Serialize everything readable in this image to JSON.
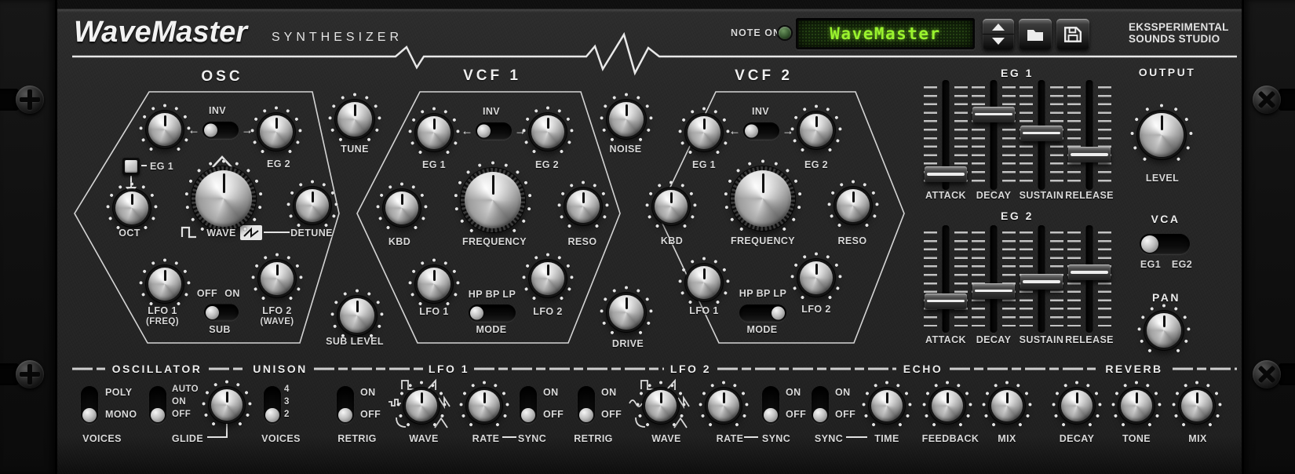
{
  "header": {
    "brand": "WaveMaster",
    "tagline": "SYNTHESIZER",
    "note_on": "NOTE ON",
    "lcd_text": "WaveMaster",
    "studio_line1": "EKSSPERIMENTAL",
    "studio_line2": "SOUNDS STUDIO"
  },
  "colors": {
    "lcd_green": "#9af22e",
    "panel": "#242424",
    "label": "#d9d9d9"
  },
  "osc": {
    "title": "OSC",
    "inv_label": "INV",
    "inv_state": "left",
    "eg1_label": "EG 1",
    "eg2_label": "EG 2",
    "oct_label": "OCT",
    "wave_label": "WAVE",
    "detune_label": "DETUNE",
    "lfo1_label": "LFO 1",
    "lfo1_sub": "(FREQ)",
    "sub_off": "OFF",
    "sub_on": "ON",
    "sub_label": "SUB",
    "sub_state": "left",
    "sub_selected": "OFF",
    "lfo2_label": "LFO 2",
    "lfo2_sub": "(WAVE)"
  },
  "tune_label": "TUNE",
  "sub_level_label": "SUB LEVEL",
  "noise_label": "NOISE",
  "drive_label": "DRIVE",
  "vcf1": {
    "title": "VCF 1",
    "inv_label": "INV",
    "inv_state": "left",
    "eg1_label": "EG 1",
    "eg2_label": "EG 2",
    "kbd_label": "KBD",
    "frequency_label": "FREQUENCY",
    "reso_label": "RESO",
    "lfo1_label": "LFO 1",
    "lfo2_label": "LFO 2",
    "mode_options": "HP BP LP",
    "mode_label": "MODE",
    "mode_state": "left",
    "mode_selected": "HP"
  },
  "vcf2": {
    "title": "VCF 2",
    "inv_label": "INV",
    "inv_state": "left",
    "eg1_label": "EG 1",
    "eg2_label": "EG 2",
    "kbd_label": "KBD",
    "frequency_label": "FREQUENCY",
    "reso_label": "RESO",
    "lfo1_label": "LFO 1",
    "lfo2_label": "LFO 2",
    "mode_options": "HP BP LP",
    "mode_label": "MODE",
    "mode_state": "right",
    "mode_selected": "LP"
  },
  "eg1": {
    "title": "EG 1",
    "sliders": [
      {
        "label": "ATTACK",
        "value": 8
      },
      {
        "label": "DECAY",
        "value": 72
      },
      {
        "label": "SUSTAIN",
        "value": 52
      },
      {
        "label": "RELEASE",
        "value": 29
      }
    ]
  },
  "eg2": {
    "title": "EG 2",
    "sliders": [
      {
        "label": "ATTACK",
        "value": 26
      },
      {
        "label": "DECAY",
        "value": 37
      },
      {
        "label": "SUSTAIN",
        "value": 47
      },
      {
        "label": "RELEASE",
        "value": 57
      }
    ]
  },
  "output": {
    "title": "OUTPUT",
    "level_label": "LEVEL"
  },
  "vca": {
    "title": "VCA",
    "eg1": "EG1",
    "eg2": "EG2",
    "state": "left",
    "selected": "EG1"
  },
  "pan": {
    "title": "PAN"
  },
  "oscillator": {
    "title": "OSCILLATOR",
    "poly": "POLY",
    "mono": "MONO",
    "voices_label": "VOICES",
    "voices_state": "bottom",
    "voices_selected": "MONO",
    "glide_auto": "AUTO",
    "glide_on": "ON",
    "glide_off": "OFF",
    "glide_label": "GLIDE",
    "glide_state": "bottom",
    "glide_selected": "OFF"
  },
  "unison": {
    "title": "UNISON",
    "v4": "4",
    "v3": "3",
    "v2": "2",
    "voices_label": "VOICES",
    "state": "bottom",
    "selected": "2"
  },
  "lfo1": {
    "title": "LFO 1",
    "retrig_label": "RETRIG",
    "retrig_on": "ON",
    "retrig_off": "OFF",
    "retrig_state": "bottom",
    "wave_label": "WAVE",
    "rate_label": "RATE",
    "sync_label": "SYNC",
    "sync_on": "ON",
    "sync_off": "OFF",
    "sync_state": "bottom"
  },
  "lfo2": {
    "title": "LFO 2",
    "retrig_label": "RETRIG",
    "retrig_on": "ON",
    "retrig_off": "OFF",
    "retrig_state": "bottom",
    "wave_label": "WAVE",
    "rate_label": "RATE",
    "sync_label": "SYNC",
    "sync_on": "ON",
    "sync_off": "OFF",
    "sync_state": "bottom"
  },
  "echo": {
    "title": "ECHO",
    "sync_label": "SYNC",
    "sync_on": "ON",
    "sync_off": "OFF",
    "sync_state": "bottom",
    "time_label": "TIME",
    "feedback_label": "FEEDBACK",
    "mix_label": "MIX"
  },
  "reverb": {
    "title": "REVERB",
    "decay_label": "DECAY",
    "tone_label": "TONE",
    "mix_label": "MIX"
  }
}
